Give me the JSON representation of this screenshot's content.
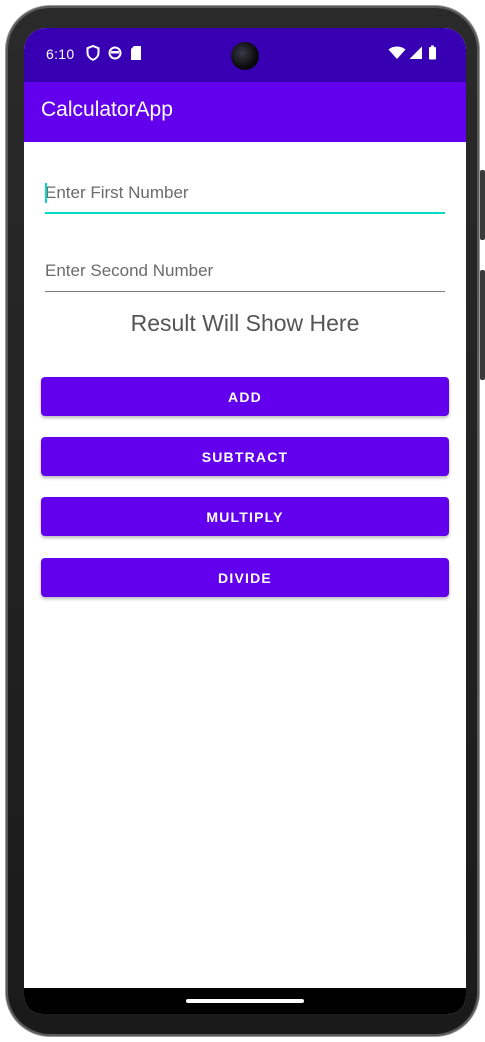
{
  "status_bar": {
    "time": "6:10",
    "background": "#3700b3",
    "left_icons": [
      "shield-icon",
      "circle-status-icon",
      "sd-card-icon"
    ],
    "right_icons": [
      "wifi-icon",
      "cell-signal-icon",
      "battery-icon"
    ]
  },
  "app_bar": {
    "title": "CalculatorApp",
    "background": "#6200ee"
  },
  "inputs": {
    "first": {
      "placeholder": "Enter First Number",
      "value": ""
    },
    "second": {
      "placeholder": "Enter Second Number",
      "value": ""
    }
  },
  "result": {
    "text": "Result Will Show Here"
  },
  "buttons": {
    "add": "ADD",
    "subtract": "SUBTRACT",
    "multiply": "MULTIPLY",
    "divide": "DIVIDE"
  },
  "colors": {
    "primary": "#6200ee",
    "primary_dark": "#3700b3",
    "accent": "#03dac5"
  }
}
